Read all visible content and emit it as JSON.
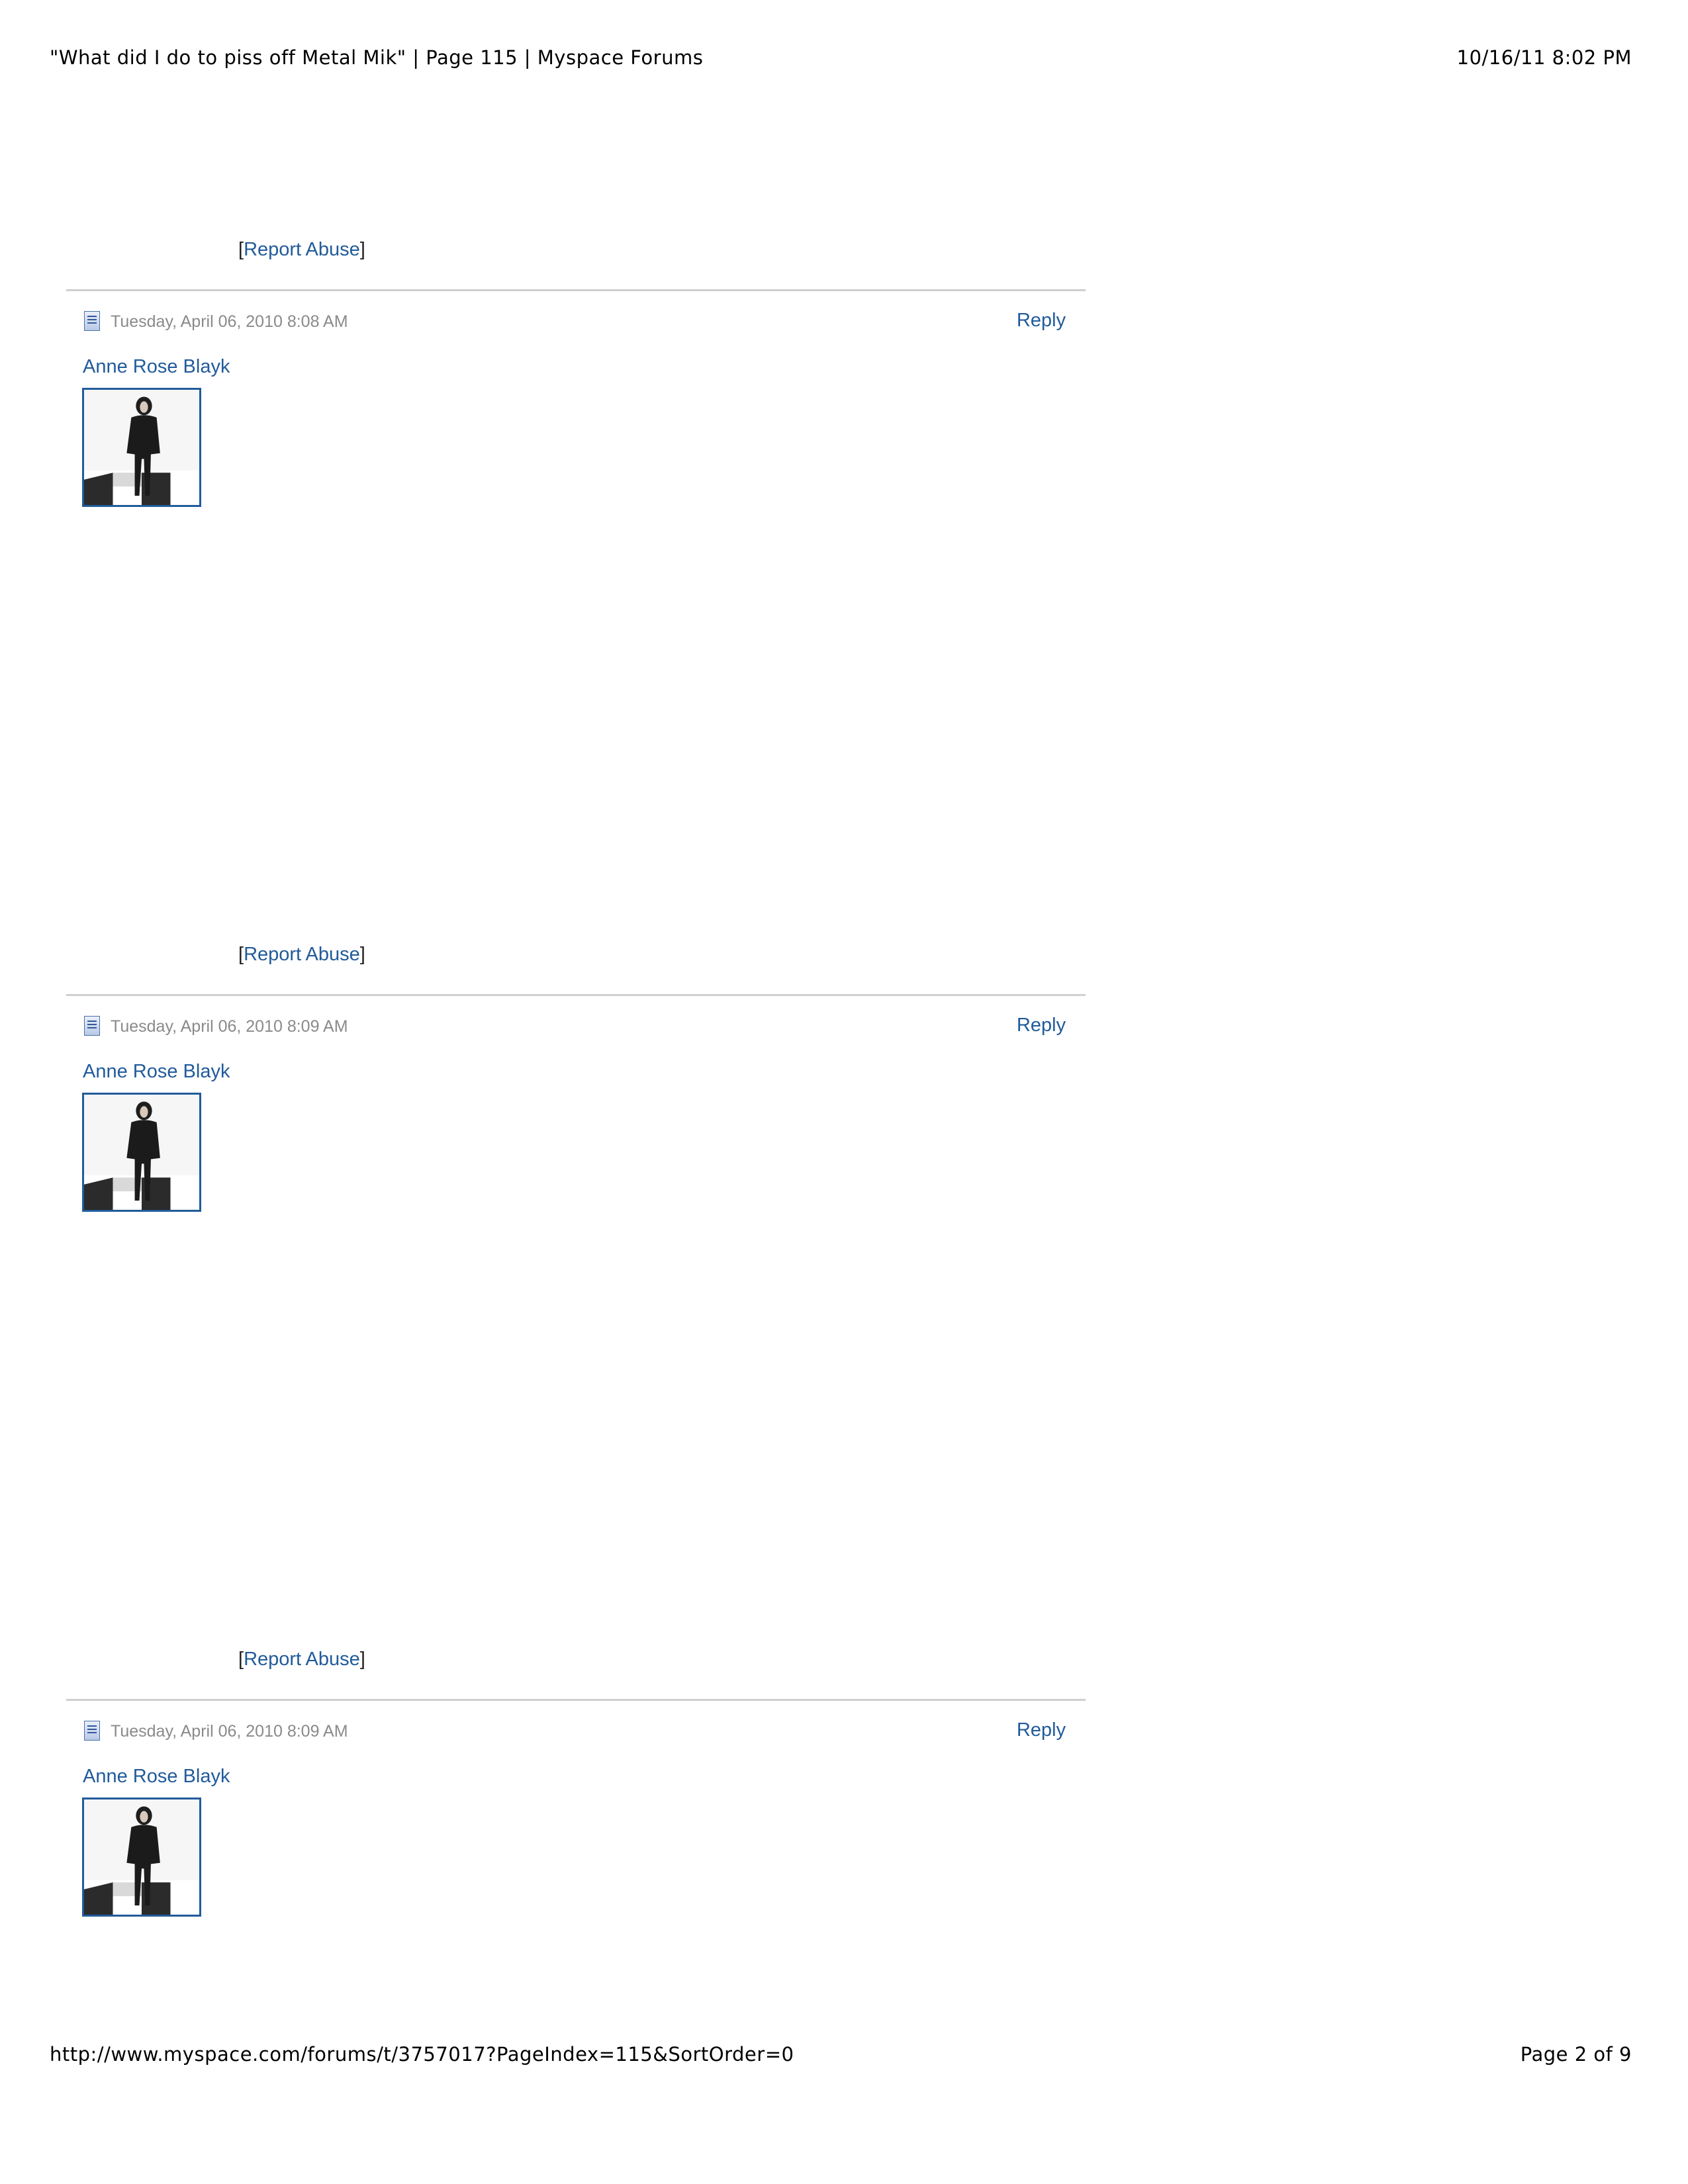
{
  "print_header": {
    "title": "\"What did I do to piss off Metal Mik\" | Page 115 | Myspace Forums",
    "datetime": "10/16/11 8:02 PM"
  },
  "print_footer": {
    "url": "http://www.myspace.com/forums/t/3757017?PageIndex=115&SortOrder=0",
    "page_label": "Page 2 of 9"
  },
  "labels": {
    "report_abuse_open": "[",
    "report_abuse": "Report Abuse",
    "report_abuse_close": "]",
    "reply": "Reply"
  },
  "posts": [
    {
      "date": "Tuesday, April 06, 2010 8:08 AM",
      "author": "Anne Rose Blayk"
    },
    {
      "date": "Tuesday, April 06, 2010 8:09 AM",
      "author": "Anne Rose Blayk"
    },
    {
      "date": "Tuesday, April 06, 2010 8:09 AM",
      "author": "Anne Rose Blayk"
    }
  ],
  "icons": {
    "post": "document-icon",
    "avatar": "user-avatar-photo"
  },
  "colors": {
    "link": "#215b9b",
    "date": "#8a8a8a",
    "divider": "#cfcfcf"
  }
}
